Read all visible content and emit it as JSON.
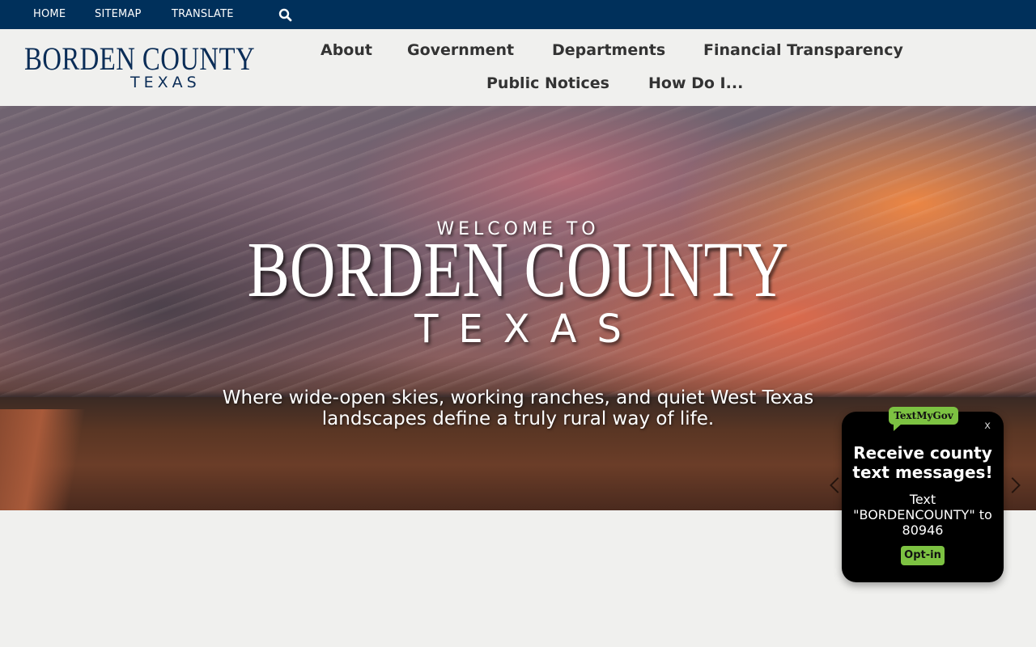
{
  "topbar": {
    "home": "HOME",
    "sitemap": "SITEMAP",
    "translate": "TRANSLATE",
    "search_icon": "search-icon",
    "background": "#00305b"
  },
  "logo": {
    "line1": "BORDEN COUNTY",
    "line2": "TEXAS",
    "color": "#0b2d57"
  },
  "nav": {
    "items": [
      {
        "label": "About"
      },
      {
        "label": "Government"
      },
      {
        "label": "Departments"
      },
      {
        "label": "Financial Transparency"
      },
      {
        "label": "Public Notices"
      },
      {
        "label": "How Do I..."
      }
    ]
  },
  "hero": {
    "welcome": "WELCOME TO",
    "title": "BORDEN COUNTY",
    "subtitle": "TEXAS",
    "tagline": "Where wide-open skies, working ranches, and quiet West Texas landscapes define a truly rural way of life.",
    "prev_icon": "chevron-left-icon",
    "next_icon": "chevron-right-icon"
  },
  "popup": {
    "badge": "TextMyGov",
    "close": "x",
    "heading": "Receive county text messages!",
    "body": "Text \"BORDENCOUNTY\" to 80946",
    "button": "Opt-in",
    "accent": "#7dc242"
  }
}
